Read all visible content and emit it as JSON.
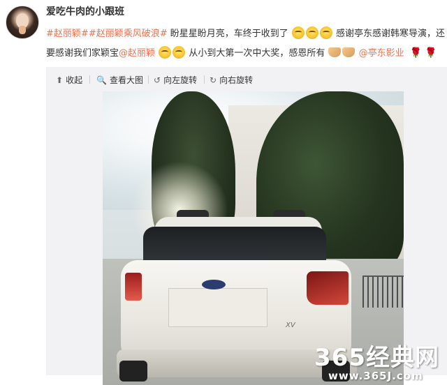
{
  "post": {
    "username": "爱吃牛肉的小跟班",
    "line1": {
      "tag1": "#赵丽颖#",
      "tag2": "#赵丽颖乘风破浪#",
      "text1": " 盼星星盼月亮，车终于收到了",
      "text2": "感谢亭东感谢韩寒导演，还"
    },
    "line2": {
      "text1": "要感谢我们家颖宝",
      "mention1": "@赵丽颖",
      "text2": " 从小到大第一次中大奖，感恩所有",
      "mention2": "@亭东影业"
    }
  },
  "toolbar": {
    "collapse_label": "收起",
    "view_large_label": "查看大图",
    "rotate_left_label": "向左旋转",
    "rotate_right_label": "向右旋转"
  },
  "photo": {
    "badge_text": "XV"
  },
  "watermark": {
    "brand": "365经典网",
    "url": "www.365J.com"
  },
  "colors": {
    "link": "#eb7350",
    "toolbar_bg": "#f2f2f5"
  }
}
